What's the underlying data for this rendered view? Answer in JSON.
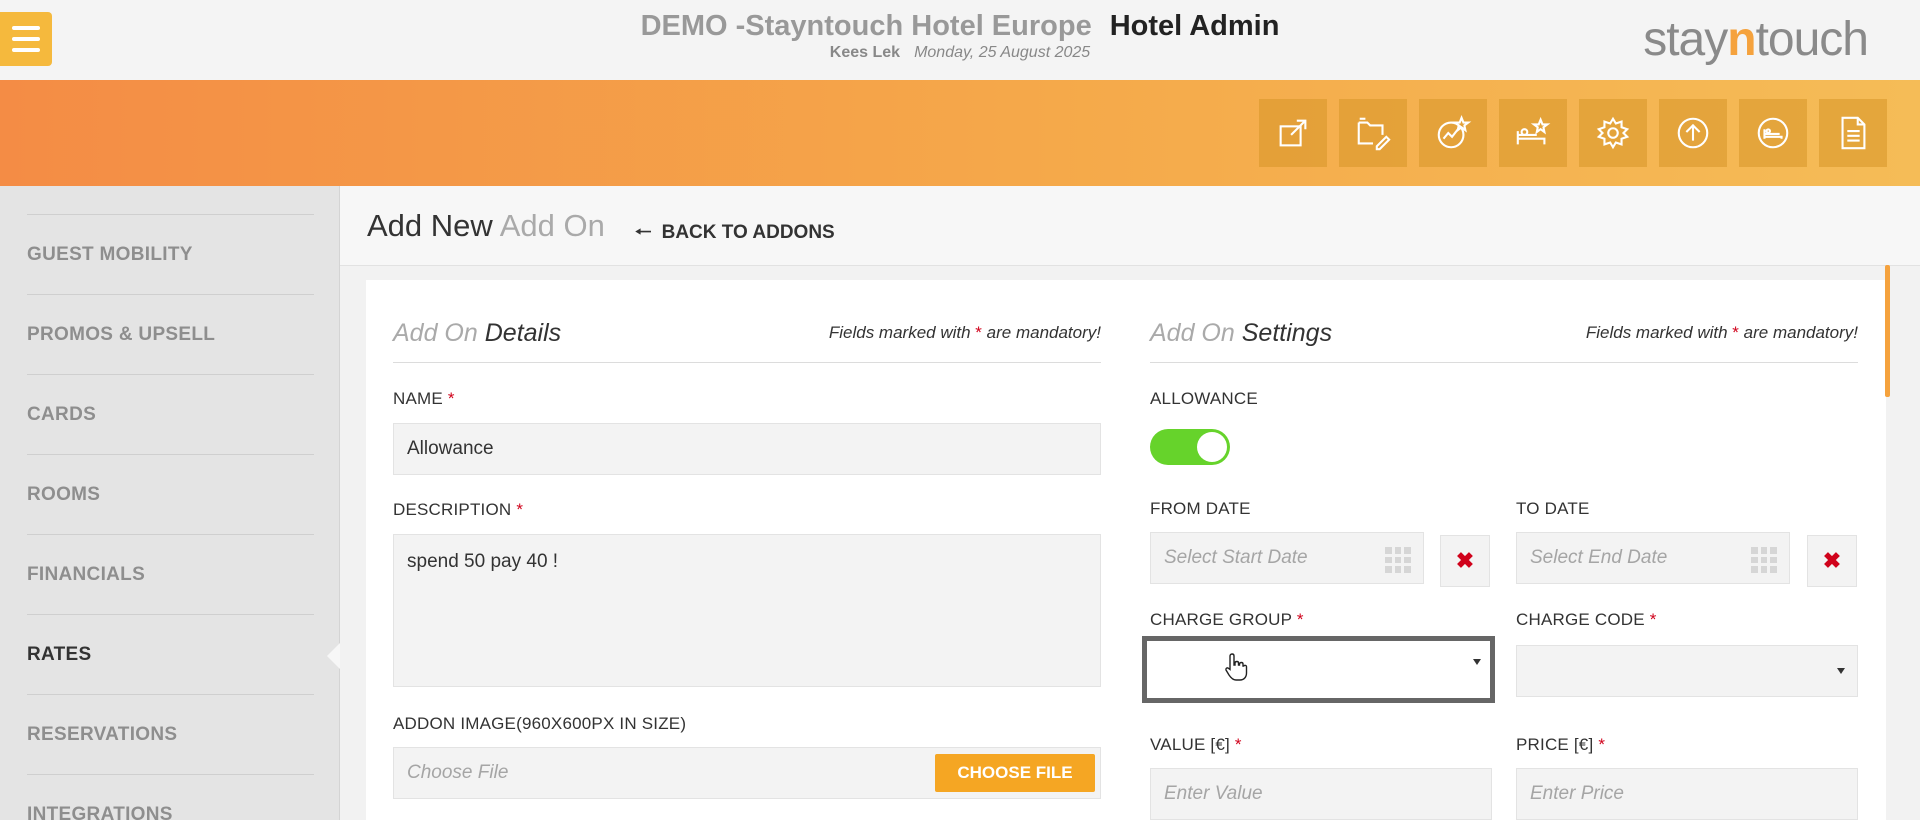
{
  "header": {
    "hotel_name": "DEMO -Stayntouch Hotel Europe",
    "section": "Hotel Admin",
    "user": "Kees Lek",
    "date": "Monday, 25 August 2025",
    "logo_pre": "stay",
    "logo_n": "n",
    "logo_post": "touch",
    "menu_icon": "hamburger-icon"
  },
  "toolbar": {
    "icons": [
      "external-link-icon",
      "folder-edit-icon",
      "chart-star-icon",
      "bed-star-icon",
      "gear-icon",
      "upload-icon",
      "bed-icon",
      "document-icon"
    ]
  },
  "sidebar": {
    "items": [
      {
        "label": "GUEST MOBILITY"
      },
      {
        "label": "PROMOS & UPSELL"
      },
      {
        "label": "CARDS"
      },
      {
        "label": "ROOMS"
      },
      {
        "label": "FINANCIALS"
      },
      {
        "label": "RATES",
        "active": true
      },
      {
        "label": "RESERVATIONS"
      },
      {
        "label": "INTEGRATIONS"
      }
    ]
  },
  "page": {
    "title_main": "Add New",
    "title_light": "Add On",
    "back_label": "BACK TO ADDONS"
  },
  "details": {
    "title_light": "Add On",
    "title_main": "Details",
    "mandatory_pre": "Fields marked with",
    "mandatory_star": "*",
    "mandatory_post": "are mandatory!",
    "name_label": "NAME",
    "name_value": "Allowance",
    "description_label": "DESCRIPTION",
    "description_value": "spend 50 pay 40 !",
    "image_label": "ADDON IMAGE(960X600PX IN SIZE)",
    "image_placeholder": "Choose File",
    "choose_button": "CHOOSE FILE"
  },
  "settings": {
    "title_light": "Add On",
    "title_main": "Settings",
    "mandatory_pre": "Fields marked with",
    "mandatory_star": "*",
    "mandatory_post": "are mandatory!",
    "allowance_label": "ALLOWANCE",
    "allowance_on": true,
    "from_date_label": "FROM DATE",
    "from_date_placeholder": "Select Start Date",
    "to_date_label": "TO DATE",
    "to_date_placeholder": "Select End Date",
    "clear_symbol": "✖",
    "charge_group_label": "CHARGE GROUP",
    "charge_code_label": "CHARGE CODE",
    "value_label": "VALUE [€]",
    "value_placeholder": "Enter Value",
    "price_label": "PRICE [€]",
    "price_placeholder": "Enter Price"
  },
  "colors": {
    "accent": "#f5a623",
    "toggle_on": "#66d32b",
    "mandatory": "#d0021b"
  }
}
